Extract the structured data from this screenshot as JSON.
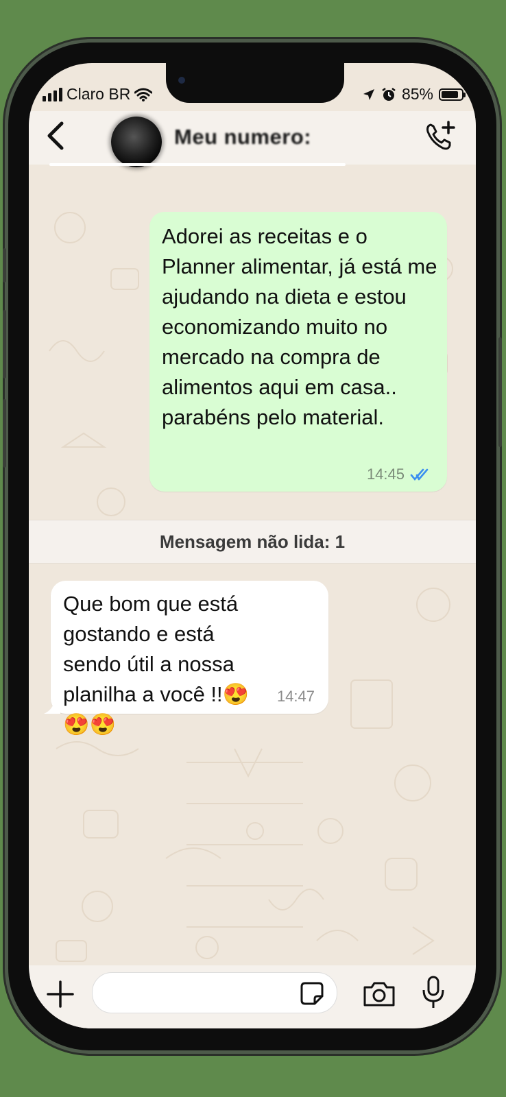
{
  "status_bar": {
    "carrier": "Claro BR",
    "battery": "85%",
    "battery_level": 0.85
  },
  "header": {
    "contact_name": "Meu numero:",
    "back_icon": "chevron-left-icon",
    "call_icon": "add-call-icon"
  },
  "messages": {
    "outgoing": {
      "text": "Adorei as receitas e o Planner alimentar, já está me ajudando na dieta e estou economizando muito no mercado na compra de alimentos aqui em casa.. parabéns pelo material.",
      "time": "14:45",
      "status_icon": "double-check-icon",
      "status_color": "#3b8ff0"
    },
    "unread_banner": "Mensagem não lida: 1",
    "incoming": {
      "text": "Que bom que está gostando e está sendo útil a nossa planilha a você !!😍😍😍",
      "time": "14:47"
    }
  },
  "composer": {
    "placeholder": "",
    "plus_icon": "plus-icon",
    "sticker_icon": "sticker-icon",
    "camera_icon": "camera-icon",
    "mic_icon": "microphone-icon"
  },
  "colors": {
    "outgoing_bubble": "#d9fdd3",
    "incoming_bubble": "#ffffff",
    "chat_background": "#efe7dc",
    "frame_background": "#5f8a4c"
  }
}
